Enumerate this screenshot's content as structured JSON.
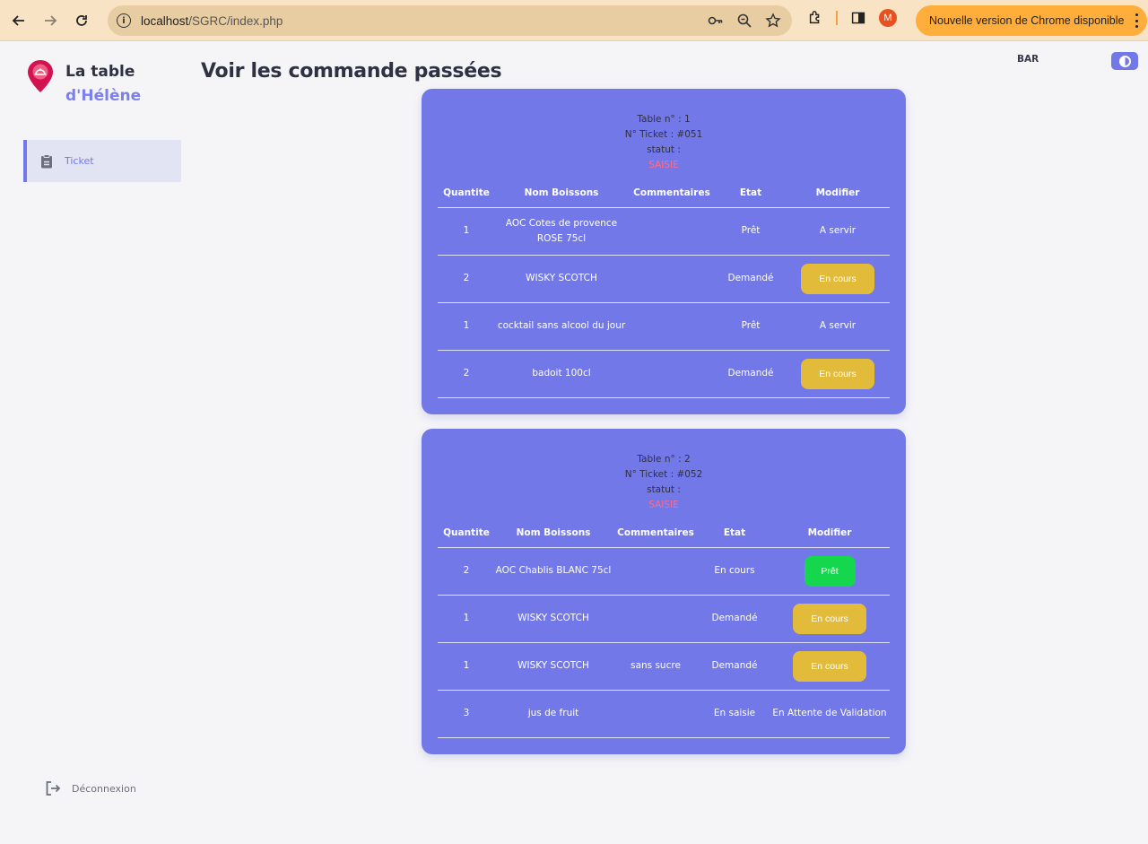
{
  "browser": {
    "url_host": "localhost",
    "url_path": "/SGRC/index.php",
    "profile_initial": "M",
    "update_label": "Nouvelle version de Chrome disponible"
  },
  "sidebar": {
    "brand_line1": "La table",
    "brand_line2": "d'Hélène",
    "items": [
      {
        "label": "Ticket",
        "icon": "clipboard-icon"
      }
    ],
    "logout_label": "Déconnexion"
  },
  "header": {
    "title": "Voir les commande passées",
    "role": "BAR"
  },
  "colors": {
    "accent": "#7378e8",
    "status_saisie": "#ff6b8a",
    "btn_yellow": "#e2bb3a",
    "btn_green": "#14d74e"
  },
  "tickets": [
    {
      "table": "Table n° : 1",
      "ticket": "N° Ticket : #051",
      "statut_label": "statut :",
      "statut": "SAISIE",
      "columns": [
        "Quantite",
        "Nom Boissons",
        "Commentaires",
        "Etat",
        "Modifier"
      ],
      "rows": [
        {
          "qty": "1",
          "name": "AOC Cotes de provence ROSE 75cl",
          "comment": "",
          "state": "Prêt",
          "action": "A servir",
          "action_type": "text"
        },
        {
          "qty": "2",
          "name": "WISKY SCOTCH",
          "comment": "",
          "state": "Demandé",
          "action": "En cours",
          "action_type": "yellow"
        },
        {
          "qty": "1",
          "name": "cocktail sans alcool du jour",
          "comment": "",
          "state": "Prêt",
          "action": "A servir",
          "action_type": "text"
        },
        {
          "qty": "2",
          "name": "badoit 100cl",
          "comment": "",
          "state": "Demandé",
          "action": "En cours",
          "action_type": "yellow"
        }
      ]
    },
    {
      "table": "Table n° : 2",
      "ticket": "N° Ticket : #052",
      "statut_label": "statut :",
      "statut": "SAISIE",
      "columns": [
        "Quantite",
        "Nom Boissons",
        "Commentaires",
        "Etat",
        "Modifier"
      ],
      "rows": [
        {
          "qty": "2",
          "name": "AOC Chablis BLANC 75cl",
          "comment": "",
          "state": "En cours",
          "action": "Prêt",
          "action_type": "green"
        },
        {
          "qty": "1",
          "name": "WISKY SCOTCH",
          "comment": "",
          "state": "Demandé",
          "action": "En cours",
          "action_type": "yellow"
        },
        {
          "qty": "1",
          "name": "WISKY SCOTCH",
          "comment": "sans sucre",
          "state": "Demandé",
          "action": "En cours",
          "action_type": "yellow"
        },
        {
          "qty": "3",
          "name": "jus de fruit",
          "comment": "",
          "state": "En saisie",
          "action": "En Attente de Validation",
          "action_type": "text"
        }
      ]
    }
  ]
}
